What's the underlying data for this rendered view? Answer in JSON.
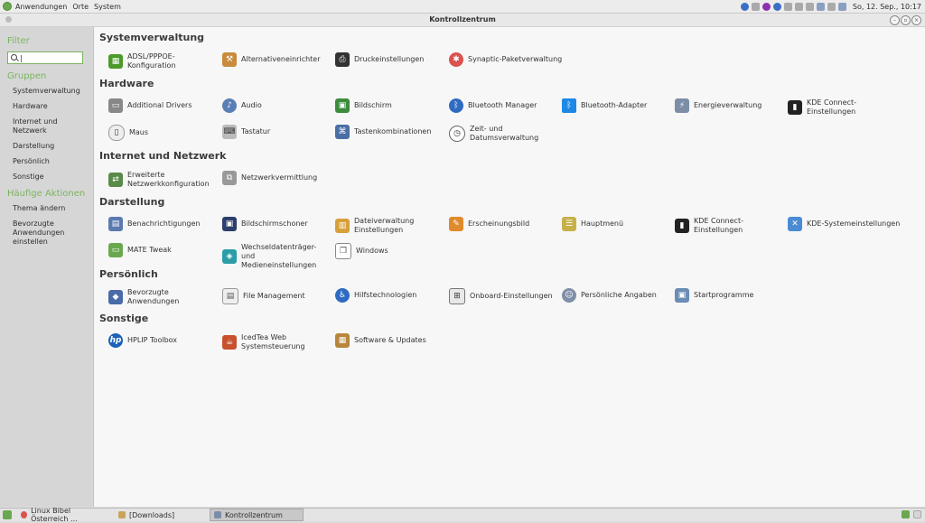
{
  "top_panel": {
    "menus": [
      "Anwendungen",
      "Orte",
      "System"
    ],
    "clock": "So, 12. Sep., 10:17"
  },
  "window": {
    "title": "Kontrollzentrum"
  },
  "sidebar": {
    "filter_heading": "Filter",
    "search_value": "|",
    "groups_heading": "Gruppen",
    "groups": [
      "Systemverwaltung",
      "Hardware",
      "Internet und Netzwerk",
      "Darstellung",
      "Persönlich",
      "Sonstige"
    ],
    "actions_heading": "Häufige Aktionen",
    "actions": [
      "Thema ändern",
      "Bevorzugte Anwendungen einstellen"
    ]
  },
  "sections": [
    {
      "title": "Systemverwaltung",
      "items": [
        "ADSL/PPPOE-Konfiguration",
        "Alternativeneinrichter",
        "Druckeinstellungen",
        "Synaptic-Paketverwaltung"
      ]
    },
    {
      "title": "Hardware",
      "items": [
        "Additional Drivers",
        "Audio",
        "Bildschirm",
        "Bluetooth Manager",
        "Bluetooth-Adapter",
        "Energieverwaltung",
        "KDE Connect-Einstellungen",
        "Maus",
        "Tastatur",
        "Tastenkombinationen",
        "Zeit- und Datumsverwaltung"
      ]
    },
    {
      "title": "Internet und Netzwerk",
      "items": [
        "Erweiterte Netzwerkkonfiguration",
        "Netzwerkvermittlung"
      ]
    },
    {
      "title": "Darstellung",
      "items": [
        "Benachrichtigungen",
        "Bildschirmschoner",
        "Dateiverwaltung Einstellungen",
        "Erscheinungsbild",
        "Hauptmenü",
        "KDE Connect-Einstellungen",
        "KDE-Systemeinstellungen",
        "MATE Tweak",
        "Wechseldatenträger- und Medieneinstellungen",
        "Windows"
      ]
    },
    {
      "title": "Persönlich",
      "items": [
        "Bevorzugte Anwendungen",
        "File Management",
        "Hilfstechnologien",
        "Onboard-Einstellungen",
        "Persönliche Angaben",
        "Startprogramme"
      ]
    },
    {
      "title": "Sonstige",
      "items": [
        "HPLIP Toolbox",
        "IcedTea Web Systemsteuerung",
        "Software & Updates"
      ]
    }
  ],
  "taskbar": {
    "tasks": [
      "Linux Bibel Österreich ...",
      "[Downloads]",
      "Kontrollzentrum"
    ]
  }
}
